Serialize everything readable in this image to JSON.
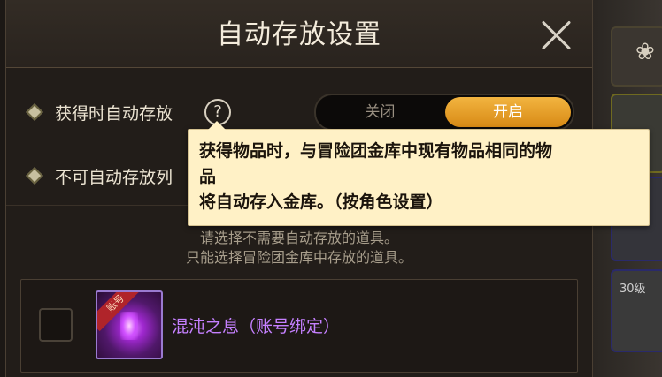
{
  "dialog": {
    "title": "自动存放设置",
    "close_label": "×"
  },
  "settings": {
    "auto_store_label": "获得时自动存放",
    "help_symbol": "?",
    "toggle_off_label": "关闭",
    "toggle_on_label": "开启",
    "toggle_state": "on",
    "exclude_list_label": "不可自动存放列"
  },
  "tooltip": {
    "line1": "获得物品时，与冒险团金库中现有物品相同的物",
    "line2": "品",
    "line3": "将自动存入金库。（按角色设置）"
  },
  "hint": {
    "line1": "请选择不需要自动存放的道具。",
    "line2": "只能选择冒险团金库中存放的道具。"
  },
  "items": [
    {
      "name": "混沌之息（账号绑定）",
      "tag": "账号",
      "checked": false
    }
  ],
  "background": {
    "slot_text": "30级"
  },
  "colors": {
    "accent_orange": "#e69a20",
    "item_purple": "#c580ff",
    "tooltip_bg": "#fff1c6"
  }
}
